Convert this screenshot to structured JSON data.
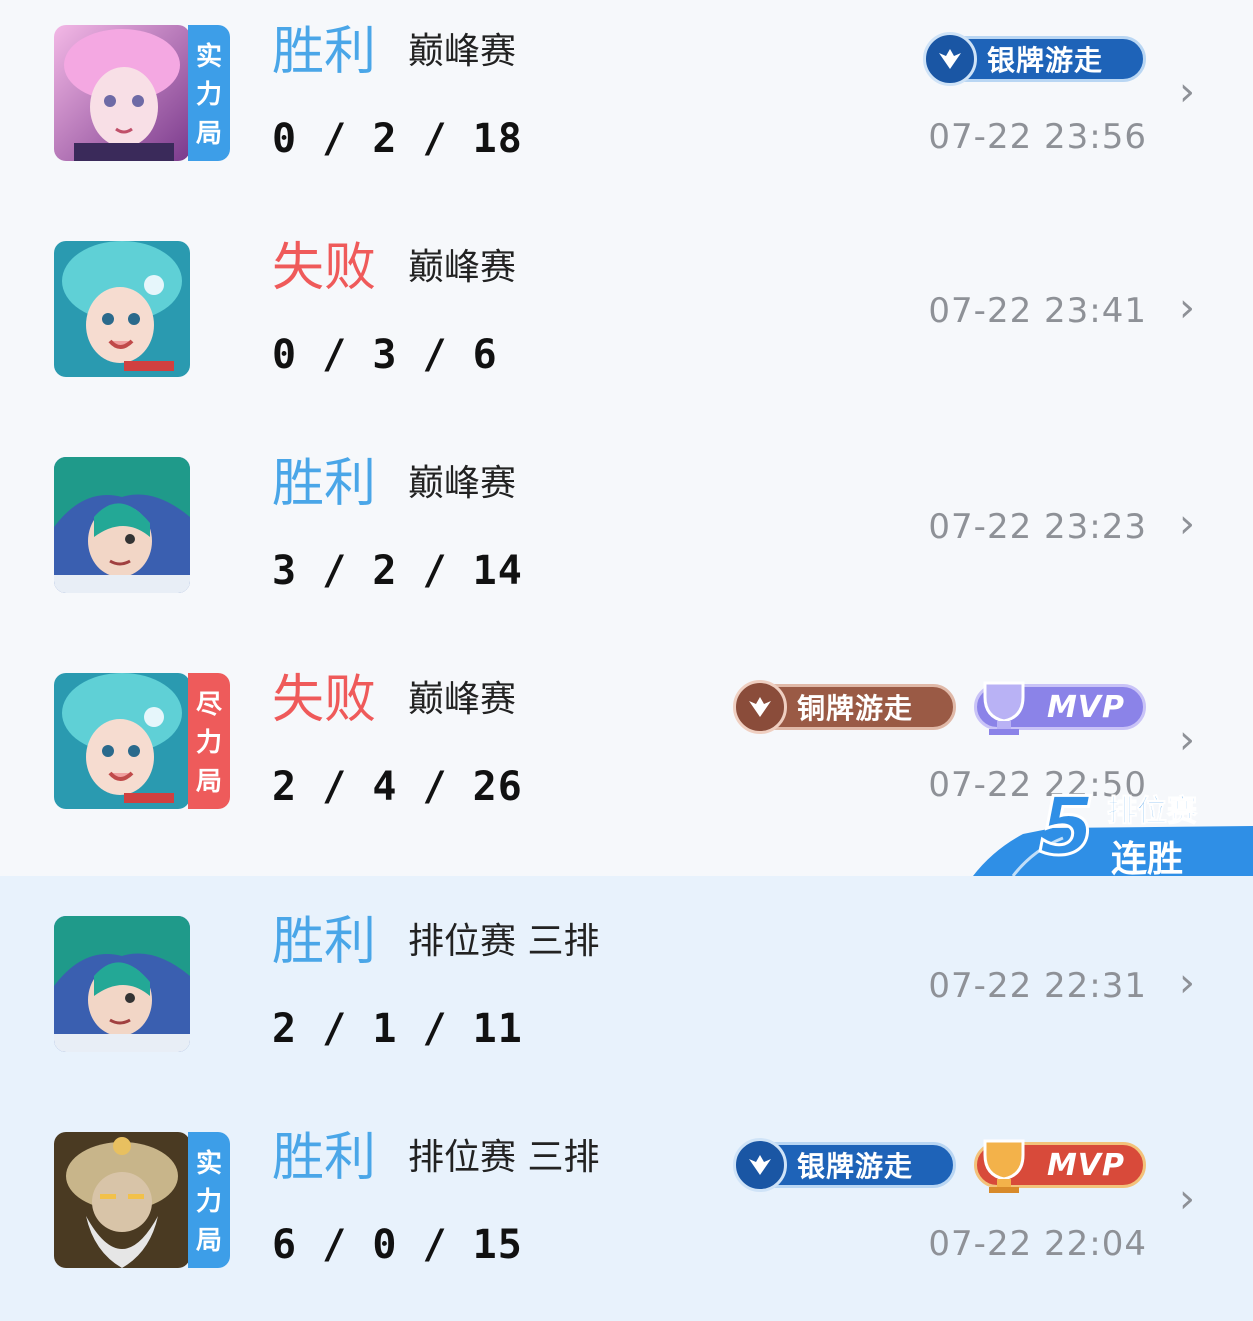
{
  "matches": [
    {
      "result": "胜利",
      "mode": "巅峰赛",
      "kda": "0 / 2 / 18",
      "time": "07-22 23:56",
      "tag": [
        "实",
        "力",
        "局"
      ],
      "badge": "银牌游走",
      "mvp": ""
    },
    {
      "result": "失败",
      "mode": "巅峰赛",
      "kda": "0 / 3 / 6",
      "time": "07-22 23:41",
      "tag": [],
      "badge": "",
      "mvp": ""
    },
    {
      "result": "胜利",
      "mode": "巅峰赛",
      "kda": "3 / 2 / 14",
      "time": "07-22 23:23",
      "tag": [],
      "badge": "",
      "mvp": ""
    },
    {
      "result": "失败",
      "mode": "巅峰赛",
      "kda": "2 / 4 / 26",
      "time": "07-22 22:50",
      "tag": [
        "尽",
        "力",
        "局"
      ],
      "badge": "铜牌游走",
      "mvp": "MVP"
    },
    {
      "result": "胜利",
      "mode": "排位赛 三排",
      "kda": "2 / 1 / 11",
      "time": "07-22 22:31",
      "tag": [],
      "badge": "",
      "mvp": ""
    },
    {
      "result": "胜利",
      "mode": "排位赛 三排",
      "kda": "6 / 0 / 15",
      "time": "07-22 22:04",
      "tag": [
        "实",
        "力",
        "局"
      ],
      "badge": "银牌游走",
      "mvp": "MVP"
    }
  ],
  "streak": {
    "number": "5",
    "line1": "排位赛",
    "line2": "连胜"
  },
  "icons": {
    "chevron": "chevron-right-icon",
    "badge": "wings-icon",
    "mvp": "trophy-icon"
  },
  "colors": {
    "win": "#4aa6e8",
    "lose": "#ef5a5a",
    "tag_blue": "#3d9ee8",
    "tag_red": "#ee5b5b",
    "streak": "#2f8fe6"
  }
}
